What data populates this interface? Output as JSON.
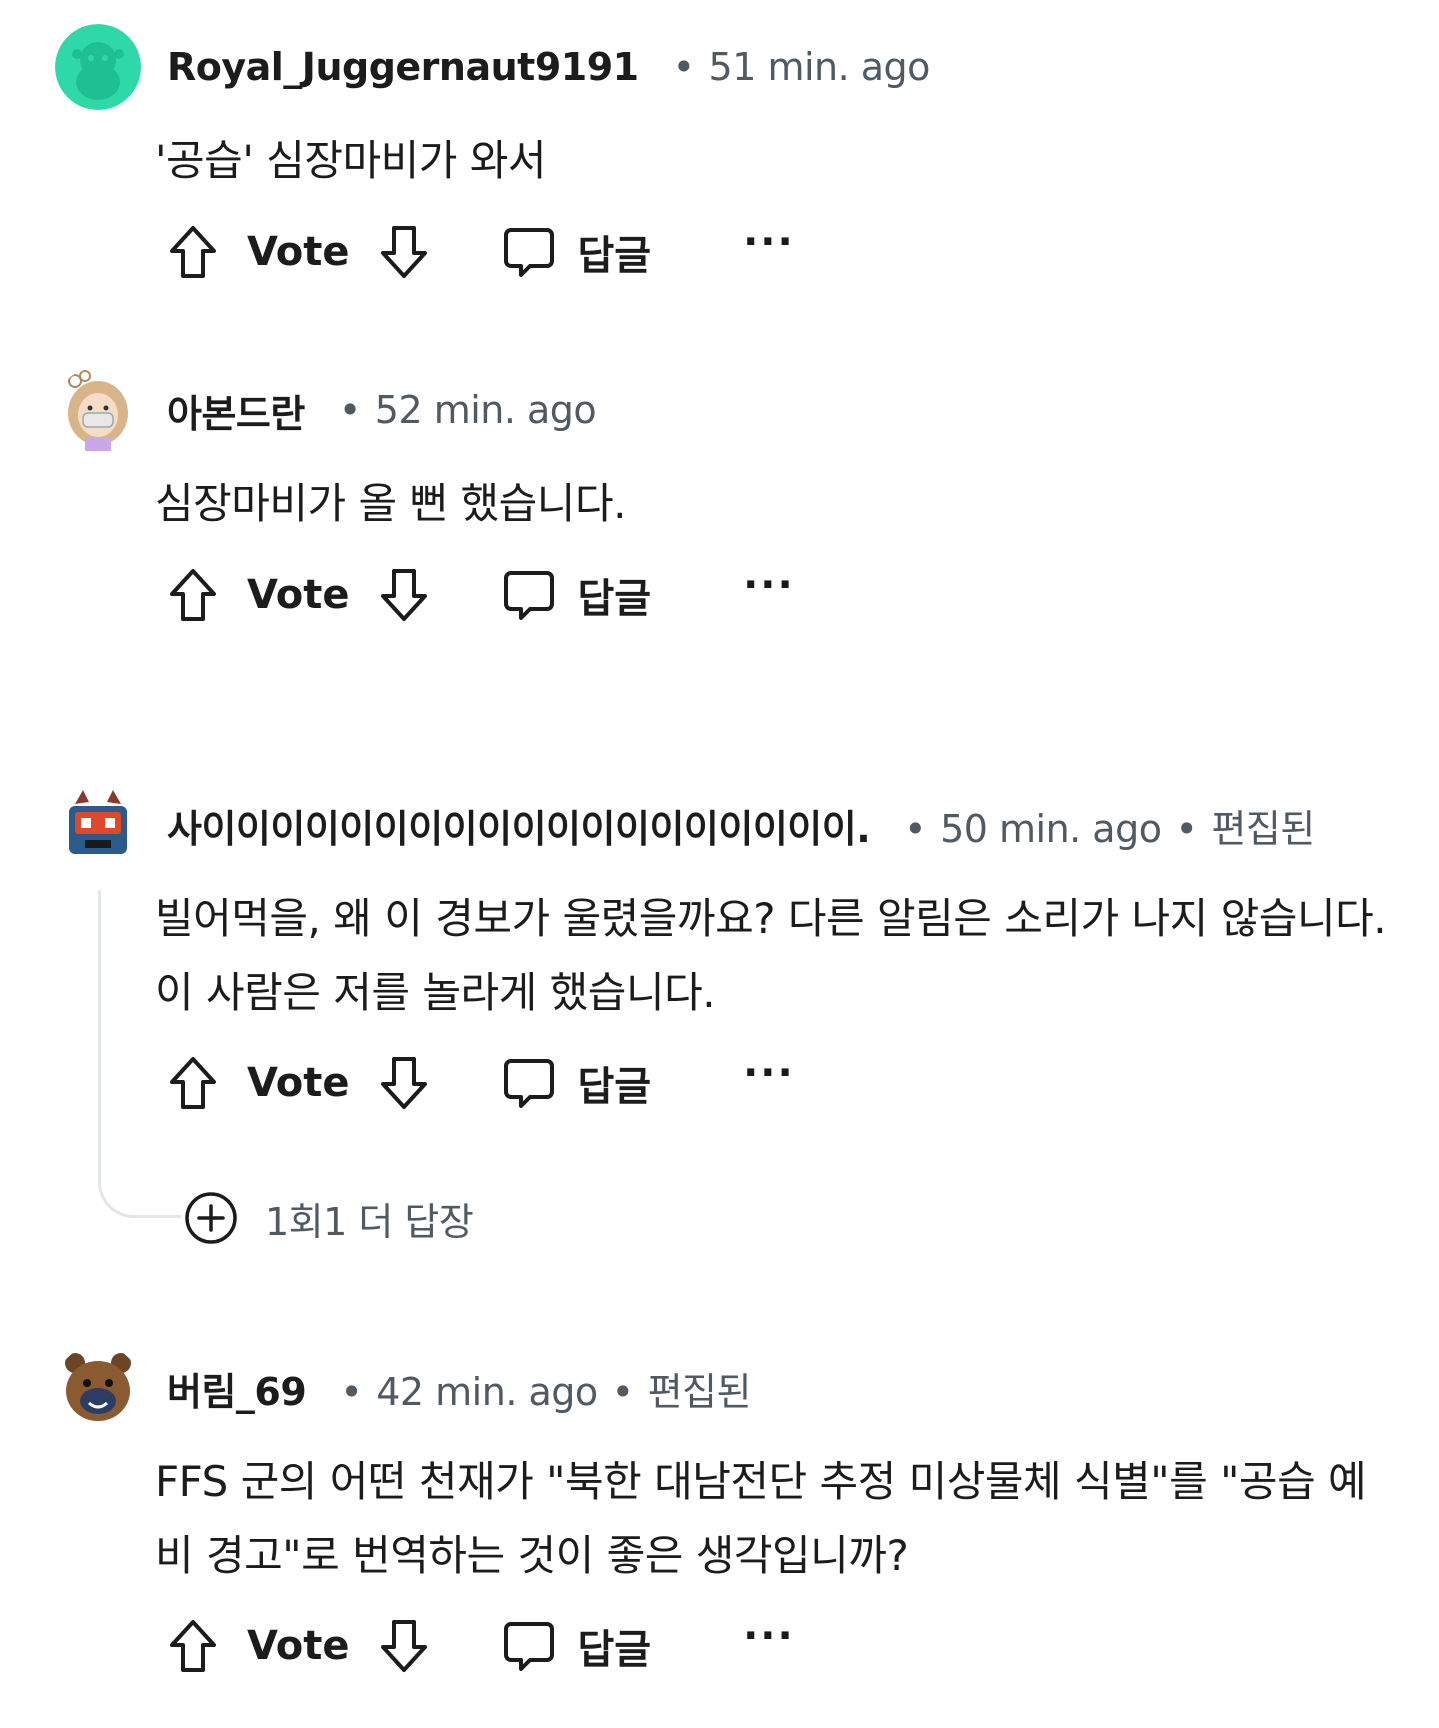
{
  "comments": [
    {
      "username": "Royal_Juggernaut9191",
      "time": "51 min. ago",
      "edited": "",
      "body": "'공습' 심장마비가 와서",
      "avatar": "snoo-teal-avatar"
    },
    {
      "username": "아본드란",
      "time": "52 min. ago",
      "edited": "",
      "body": "심장마비가 올 뻔 했습니다.",
      "avatar": "girl-mask-avatar"
    },
    {
      "username": "사이이이이이이이이이이이이이이이이이이이.",
      "time": "50 min. ago",
      "edited": "편집된",
      "body": "빌어먹을, 왜 이 경보가 울렸을까요? 다른 알림은 소리가 나지 않습니다. 이 사람은 저를 놀라게 했습니다.",
      "avatar": "robot-avatar"
    },
    {
      "username": "버림_69",
      "time": "42 min. ago",
      "edited": "편집된",
      "body": "FFS 군의 어떤 천재가 \"북한 대남전단 추정 미상물체 식별\"를 \"공습 예비 경고\"로 번역하는 것이 좋은 생각입니까?",
      "avatar": "bear-avatar"
    }
  ],
  "actions": {
    "vote_label": "Vote",
    "reply_label": "답글",
    "more_label": "···"
  },
  "more_replies": {
    "label": "1회1 더 답장"
  },
  "meta_separator": "•",
  "colors": {
    "text": "#1c1c1c",
    "meta": "#4f5a63",
    "thread_line": "#e3e6e8",
    "avatar_teal": "#2ed8a8"
  }
}
